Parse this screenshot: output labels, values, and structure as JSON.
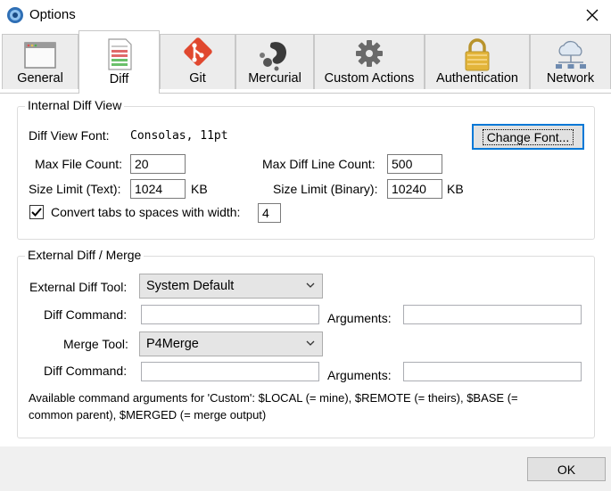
{
  "window": {
    "title": "Options"
  },
  "tabs": [
    {
      "label": "General",
      "icon": "window-icon"
    },
    {
      "label": "Diff",
      "icon": "diff-document-icon"
    },
    {
      "label": "Git",
      "icon": "git-icon"
    },
    {
      "label": "Mercurial",
      "icon": "mercurial-icon"
    },
    {
      "label": "Custom Actions",
      "icon": "gear-icon"
    },
    {
      "label": "Authentication",
      "icon": "padlock-icon"
    },
    {
      "label": "Network",
      "icon": "network-cloud-icon"
    }
  ],
  "active_tab": "Diff",
  "internal": {
    "title": "Internal Diff View",
    "font_label": "Diff View Font:",
    "font_value": "Consolas, 11pt",
    "change_font": "Change Font...",
    "max_file_label": "Max File Count:",
    "max_file_value": "20",
    "max_diff_label": "Max Diff Line Count:",
    "max_diff_value": "500",
    "size_text_label": "Size Limit (Text):",
    "size_text_value": "1024",
    "size_text_unit": "KB",
    "size_bin_label": "Size Limit (Binary):",
    "size_bin_value": "10240",
    "size_bin_unit": "KB",
    "tabs_label": "Convert tabs to spaces with width:",
    "tabs_checked": true,
    "tabs_value": "4"
  },
  "external": {
    "title": "External Diff / Merge",
    "diff_tool_label": "External Diff Tool:",
    "diff_tool_value": "System Default",
    "diff_cmd_label": "Diff Command:",
    "diff_cmd_value": "",
    "diff_args_label": "Arguments:",
    "diff_args_value": "",
    "merge_tool_label": "Merge Tool:",
    "merge_tool_value": "P4Merge",
    "merge_cmd_label": "Diff Command:",
    "merge_cmd_value": "",
    "merge_args_label": "Arguments:",
    "merge_args_value": "",
    "note_line1": "Available command arguments for 'Custom': $LOCAL (= mine), $REMOTE (= theirs), $BASE (=",
    "note_line2": "common parent), $MERGED (= merge output)"
  },
  "footer": {
    "ok": "OK"
  }
}
